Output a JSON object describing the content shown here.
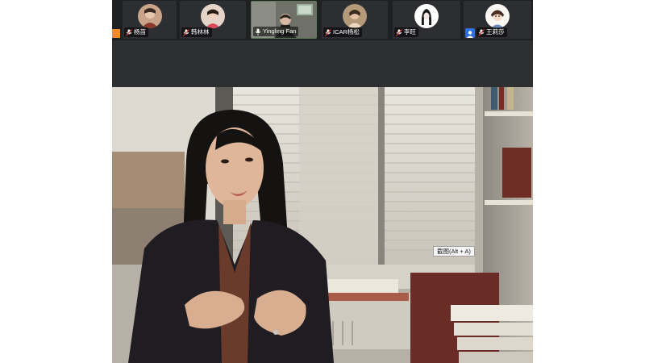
{
  "participants": [
    {
      "name": "杨苗",
      "mic": "mic-muted-icon",
      "avatar": "photo"
    },
    {
      "name": "韩林林",
      "mic": "mic-muted-icon",
      "avatar": "photo"
    },
    {
      "name": "Yingling Fan",
      "mic": "mic-on-icon",
      "avatar": "video",
      "active": true
    },
    {
      "name": "ICAR杨松",
      "mic": "mic-muted-icon",
      "avatar": "photo"
    },
    {
      "name": "李旺",
      "mic": "mic-muted-icon",
      "avatar": "illustration"
    },
    {
      "name": "王莉莎",
      "mic": "mic-muted-icon",
      "avatar": "illustration"
    }
  ],
  "screenshot_tooltip": "截图(Alt + A)",
  "colors": {
    "toolbar_bg": "#1f2022",
    "tile_bg": "#2d2e31",
    "active_tile": "#4c4f46",
    "accent_orange": "#f28c28",
    "accent_blue": "#2e6fe0"
  }
}
